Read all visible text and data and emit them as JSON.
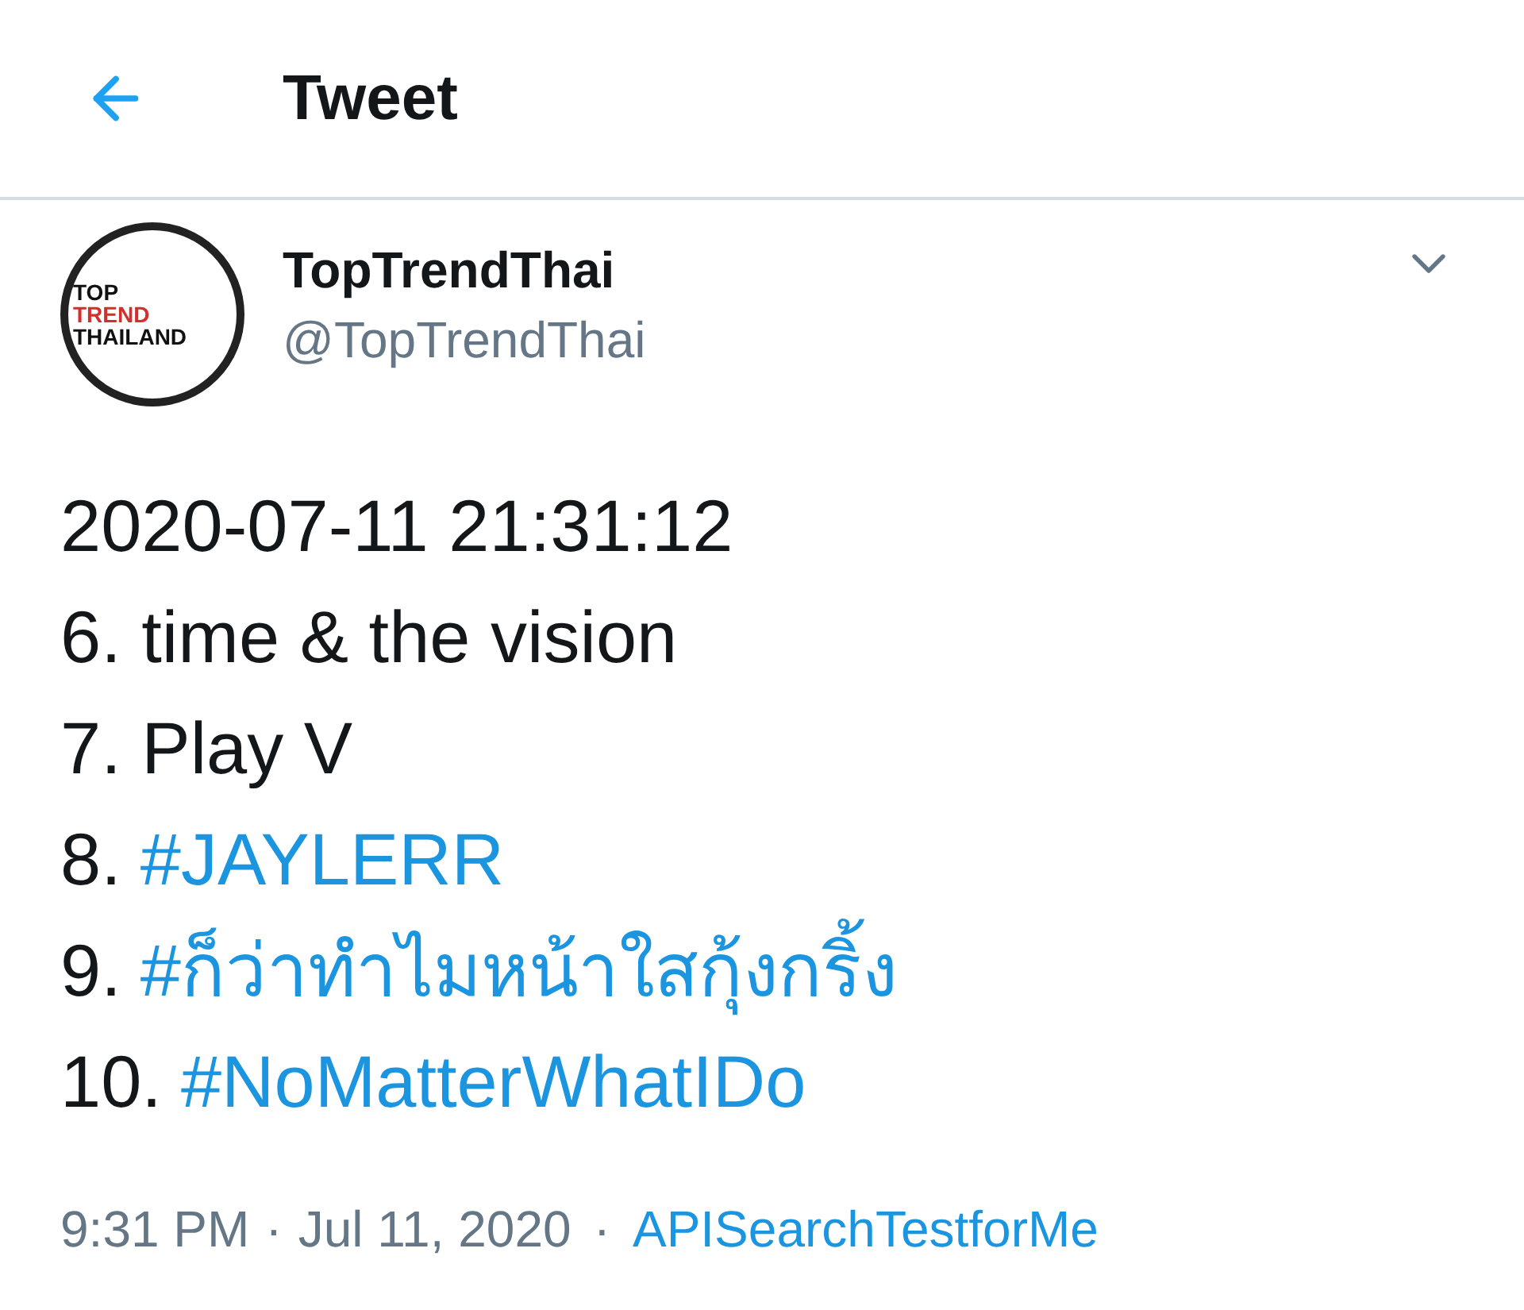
{
  "header": {
    "title": "Tweet"
  },
  "author": {
    "name": "TopTrendThai",
    "handle": "@TopTrendThai",
    "avatar_lines": [
      "TOP",
      "TREND",
      "THAILAND"
    ]
  },
  "lines": [
    {
      "kind": "plain",
      "text": "2020-07-11 21:31:12"
    },
    {
      "kind": "plain",
      "text": "6. time & the vision"
    },
    {
      "kind": "plain",
      "text": "7. Play V"
    },
    {
      "kind": "hashtag",
      "number": "8.",
      "text": "#JAYLERR"
    },
    {
      "kind": "hashtag",
      "number": "9.",
      "text": "#ก็ว่าทำไมหน้าใสกุ้งกริ้ง"
    },
    {
      "kind": "hashtag",
      "number": "10.",
      "text": "#NoMatterWhatIDo"
    }
  ],
  "footer": {
    "time": "9:31 PM",
    "separator_1": "·",
    "date": "Jul 11, 2020",
    "separator_2": "·",
    "source": "APISearchTestforMe"
  }
}
